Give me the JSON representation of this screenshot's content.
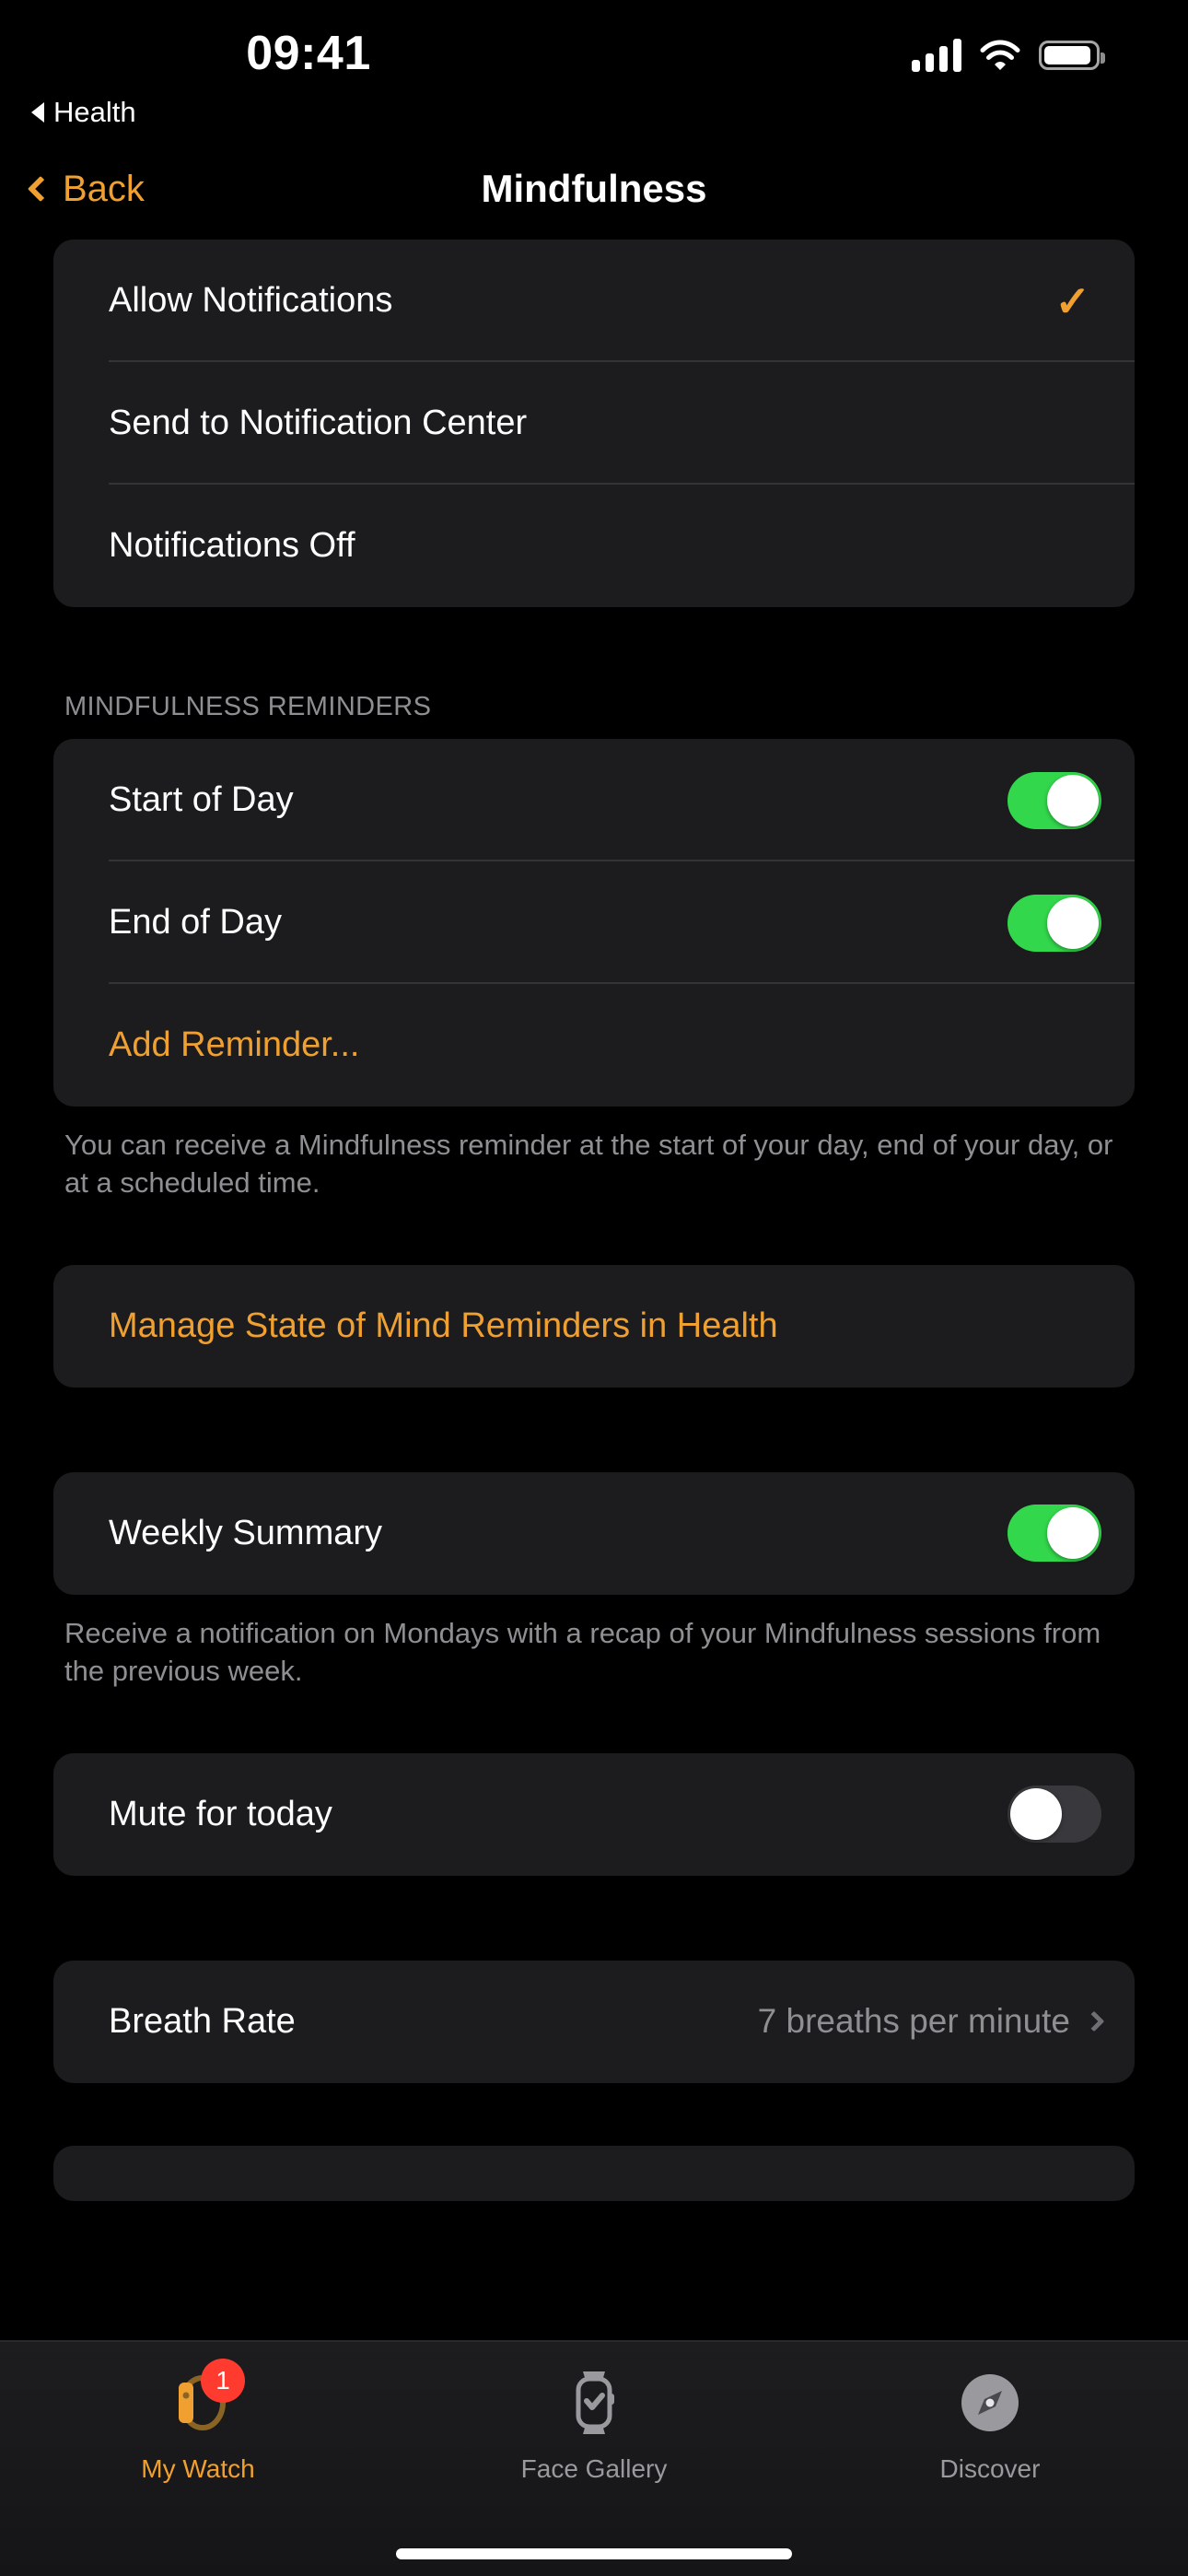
{
  "status_bar": {
    "time": "09:41",
    "back_crumb": "Health",
    "cellular_icon": "cellular-signal-icon",
    "wifi_icon": "wifi-icon",
    "battery_icon": "battery-icon"
  },
  "nav": {
    "back_label": "Back",
    "title": "Mindfulness",
    "back_icon": "chevron-left-icon"
  },
  "notification_mode": {
    "options": [
      {
        "label": "Allow Notifications",
        "selected": true,
        "check_icon": "checkmark-icon"
      },
      {
        "label": "Send to Notification Center",
        "selected": false
      },
      {
        "label": "Notifications Off",
        "selected": false
      }
    ]
  },
  "reminders": {
    "header": "MINDFULNESS REMINDERS",
    "rows": [
      {
        "label": "Start of Day",
        "toggle": "on"
      },
      {
        "label": "End of Day",
        "toggle": "on"
      }
    ],
    "add_label": "Add Reminder...",
    "footnote": "You can receive a Mindfulness reminder at the start of your day, end of your day, or at a scheduled time."
  },
  "manage_link": {
    "label": "Manage State of Mind Reminders in Health"
  },
  "weekly_summary": {
    "label": "Weekly Summary",
    "toggle": "on",
    "footnote": "Receive a notification on Mondays with a recap of your Mindfulness sessions from the previous week."
  },
  "mute": {
    "label": "Mute for today",
    "toggle": "off"
  },
  "breath_rate": {
    "label": "Breath Rate",
    "value": "7 breaths per minute",
    "chevron_icon": "chevron-right-icon"
  },
  "tabs": [
    {
      "label": "My Watch",
      "icon": "watch-side-icon",
      "active": true,
      "badge": "1"
    },
    {
      "label": "Face Gallery",
      "icon": "watch-face-icon",
      "active": false
    },
    {
      "label": "Discover",
      "icon": "compass-icon",
      "active": false
    }
  ],
  "colors": {
    "accent": "#F0A030",
    "toggle_on": "#32D74B",
    "toggle_off": "#39393D",
    "badge": "#FF3B30",
    "card": "#1C1C1E",
    "secondary_text": "#8E8E93"
  }
}
